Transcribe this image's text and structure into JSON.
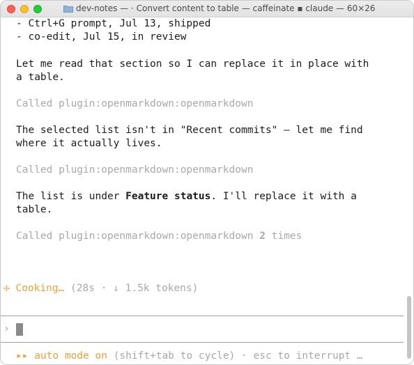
{
  "window": {
    "title": "dev-notes — · Convert content to table — caffeinate ▪ claude — 60×26"
  },
  "transcript": {
    "list_line_1": "- Ctrl+G prompt, Jul 13, shipped",
    "list_line_2": "- co-edit, Jul 15, in review",
    "msg1_line1": "Let me read that section so I can replace it in place with",
    "msg1_line2": "a table.",
    "tool1": "Called plugin:openmarkdown:openmarkdown",
    "msg2_line1": "The selected list isn't in \"Recent commits\" — let me find",
    "msg2_line2": "where it actually lives.",
    "tool2": "Called plugin:openmarkdown:openmarkdown",
    "msg3_pre": "The list is under ",
    "msg3_bold": "Feature status",
    "msg3_post": ". I'll replace it with a",
    "msg3_line2": "table.",
    "tool3_pre": "Called plugin:openmarkdown:openmarkdown ",
    "tool3_count": "2",
    "tool3_post": " times"
  },
  "activity": {
    "star": "✢",
    "word": "Cooking…",
    "meta": " (28s · ↓ 1.5k tokens)"
  },
  "prompt": {
    "caret": "›"
  },
  "status_bar": {
    "arrows": "▸▸",
    "mode": " auto mode on",
    "rest": " (shift+tab to cycle) · esc to interrupt …"
  },
  "colors": {
    "accent": "#e8a13a",
    "dim": "#a8a8a8"
  }
}
